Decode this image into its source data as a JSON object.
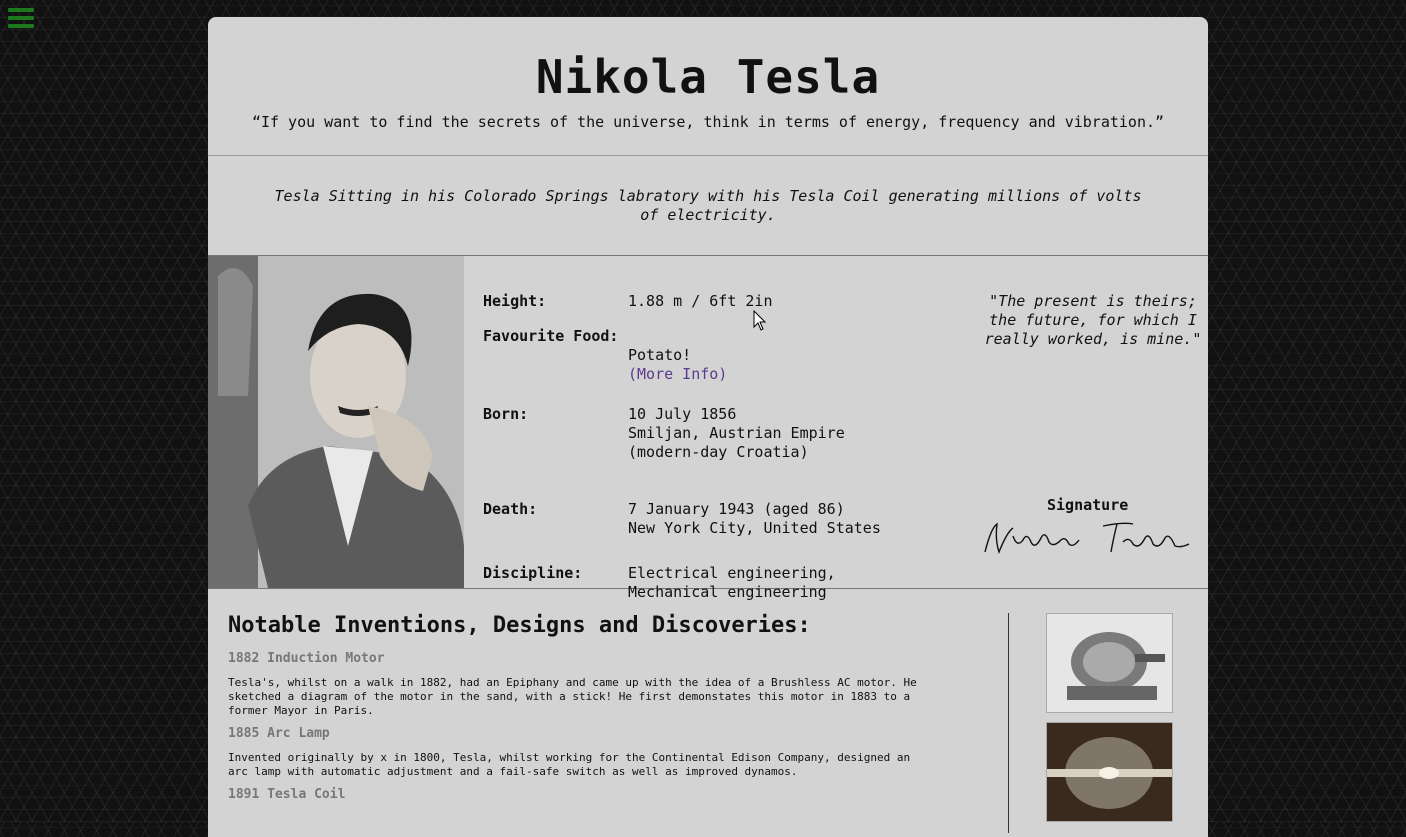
{
  "page": {
    "title": "Nikola Tesla",
    "quote": "“If you want to find the secrets of the universe, think in terms of energy, frequency and vibration.”",
    "caption": "Tesla Sitting in his Colorado Springs labratory with his Tesla Coil generating millions of volts of electricity."
  },
  "facts": [
    {
      "label": "Height:",
      "value": "1.88 m / 6ft 2in"
    },
    {
      "label": "Favourite Food:",
      "value": "Potato!",
      "link": "(More Info)"
    },
    {
      "label": "Born:",
      "value": "10 July 1856\nSmiljan, Austrian Empire\n(modern-day Croatia)"
    },
    {
      "label": "Death:",
      "value": "7 January 1943 (aged 86)\nNew York City, United States"
    },
    {
      "label": "Discipline:",
      "value": "Electrical engineering,\nMechanical engineering"
    }
  ],
  "side": {
    "quote": "\"The present is theirs; the future, for which I really worked, is mine.\"",
    "signature_heading": "Signature",
    "signature_text": "Nikola Tesla"
  },
  "inventions": {
    "heading": "Notable Inventions, Designs and Discoveries:",
    "items": [
      {
        "title": "1882 Induction Motor",
        "text": "Tesla's, whilst on a walk in 1882, had an Epiphany and came up with the idea of a Brushless AC motor. He sketched a diagram of the motor in the sand, with a stick! He first demonstates this motor in 1883 to a former Mayor in Paris."
      },
      {
        "title": "1885 Arc Lamp",
        "text": "Invented originally by x in 1800, Tesla, whilst working for the Continental Edison Company, designed an arc lamp with automatic adjustment and a fail-safe switch as well as improved dynamos."
      },
      {
        "title": "1891 Tesla Coil",
        "text": ""
      }
    ]
  },
  "colors": {
    "menu": "#1c7a1c",
    "card": "#d3d3d3",
    "link": "#5a3a8e"
  }
}
